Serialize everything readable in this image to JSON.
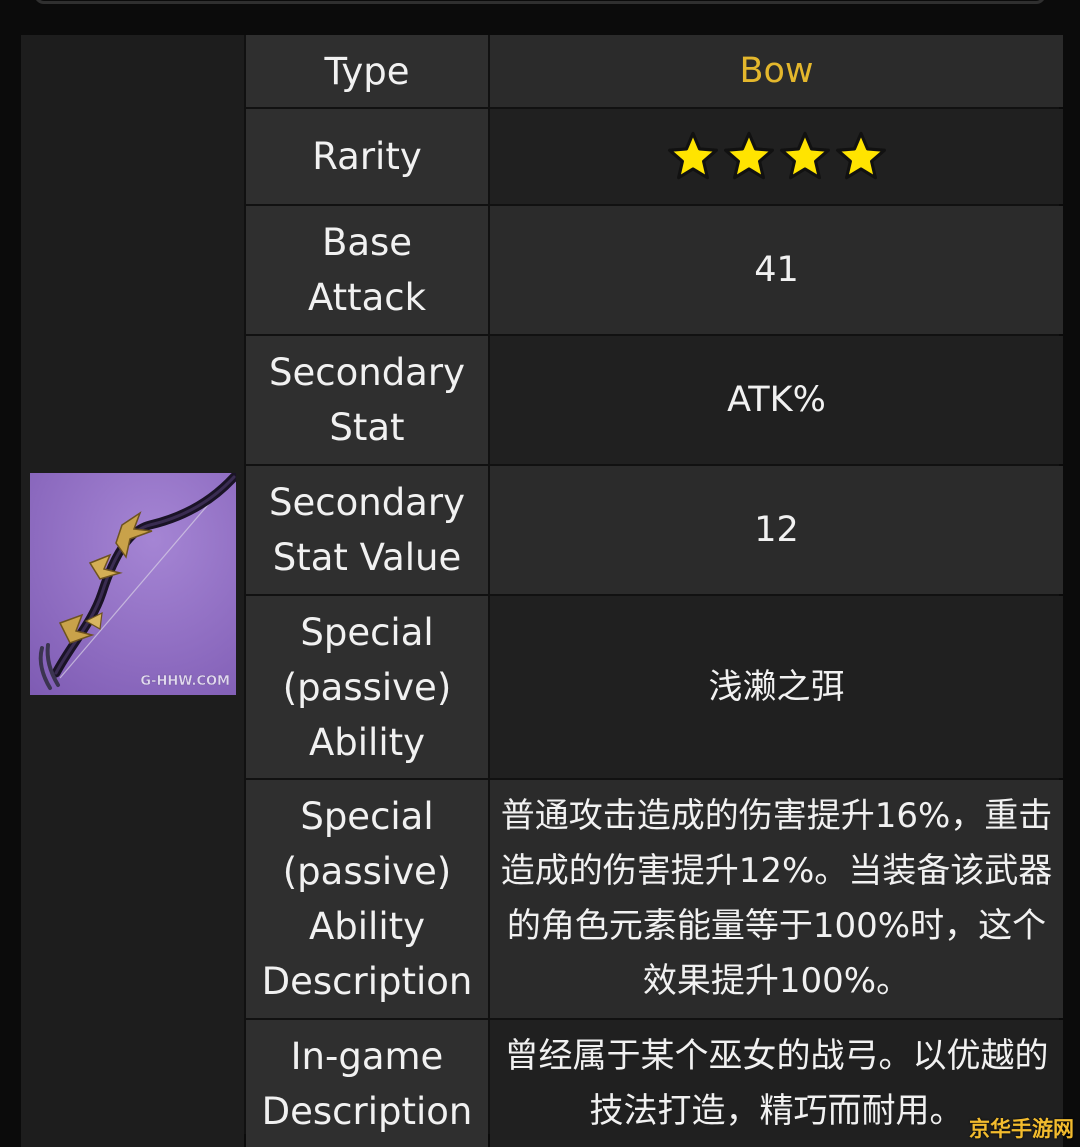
{
  "rows": [
    {
      "label": "Type",
      "value": "Bow"
    },
    {
      "label": "Rarity",
      "value": "4"
    },
    {
      "label": "Base\nAttack",
      "value": "41"
    },
    {
      "label": "Secondary\nStat",
      "value": "ATK%"
    },
    {
      "label": "Secondary\nStat Value",
      "value": "12"
    },
    {
      "label": "Special\n(passive)\nAbility",
      "value": "浅濑之弭"
    },
    {
      "label": "Special\n(passive)\nAbility\nDescription",
      "value": "普通攻击造成的伤害提升16%，重击造成的伤害提升12%。当装备该武器的角色元素能量等于100%时，这个效果提升100%。"
    },
    {
      "label": "In-game\nDescription",
      "value": "曾经属于某个巫女的战弓。以优越的技法打造，精巧而耐用。"
    }
  ],
  "rarity_stars": 4,
  "image": {
    "watermark": "G-HHW.COM",
    "icon": "bow-weapon-icon"
  },
  "site_watermark": "京华手游网",
  "colors": {
    "gold_text": "#e4b72c",
    "star": "#ffe400",
    "image_bg": "#9170c4"
  }
}
